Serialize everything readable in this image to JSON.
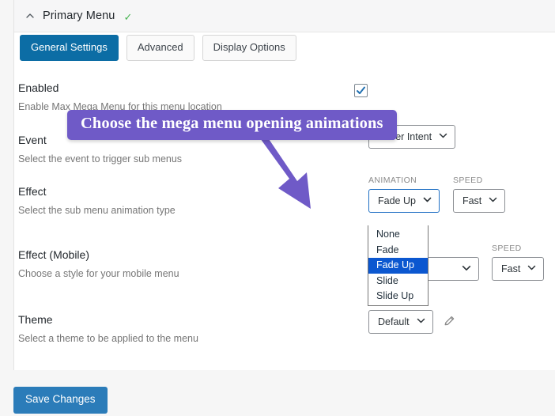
{
  "panel": {
    "title": "Primary Menu",
    "status_icon": "check-icon",
    "status_glyph": "✓",
    "collapse_icon": "chevron-up-icon"
  },
  "tabs": [
    {
      "label": "General Settings",
      "active": true
    },
    {
      "label": "Advanced",
      "active": false
    },
    {
      "label": "Display Options",
      "active": false
    }
  ],
  "settings": {
    "enabled": {
      "label": "Enabled",
      "desc": "Enable Max Mega Menu for this menu location",
      "checked": true
    },
    "event": {
      "label": "Event",
      "desc": "Select the event to trigger sub menus",
      "value": "Hover Intent"
    },
    "effect": {
      "label": "Effect",
      "desc": "Select the sub menu animation type",
      "animation_label": "ANIMATION",
      "animation_value": "Fade Up",
      "speed_label": "SPEED",
      "speed_value": "Fast",
      "options": [
        "None",
        "Fade",
        "Fade Up",
        "Slide",
        "Slide Up"
      ],
      "selected_option": "Fade Up"
    },
    "effect_mobile": {
      "label": "Effect (Mobile)",
      "desc": "Choose a style for your mobile menu",
      "animation_value": "",
      "speed_label": "SPEED",
      "speed_value": "Fast"
    },
    "theme": {
      "label": "Theme",
      "desc": "Select a theme to be applied to the menu",
      "value": "Default",
      "edit_icon": "pencil-icon"
    }
  },
  "footer": {
    "save_label": "Save Changes"
  },
  "annotation": {
    "tooltip_text": "Choose the mega menu opening animations",
    "color": "#6f5ac7",
    "arrow_icon": "arrow-down-right-icon"
  },
  "colors": {
    "accent_blue": "#0c6da5",
    "save_blue": "#2b7cb9",
    "selected_option_blue": "#0b57d0",
    "status_green": "#46b450",
    "annotation_purple": "#6f5ac7"
  }
}
